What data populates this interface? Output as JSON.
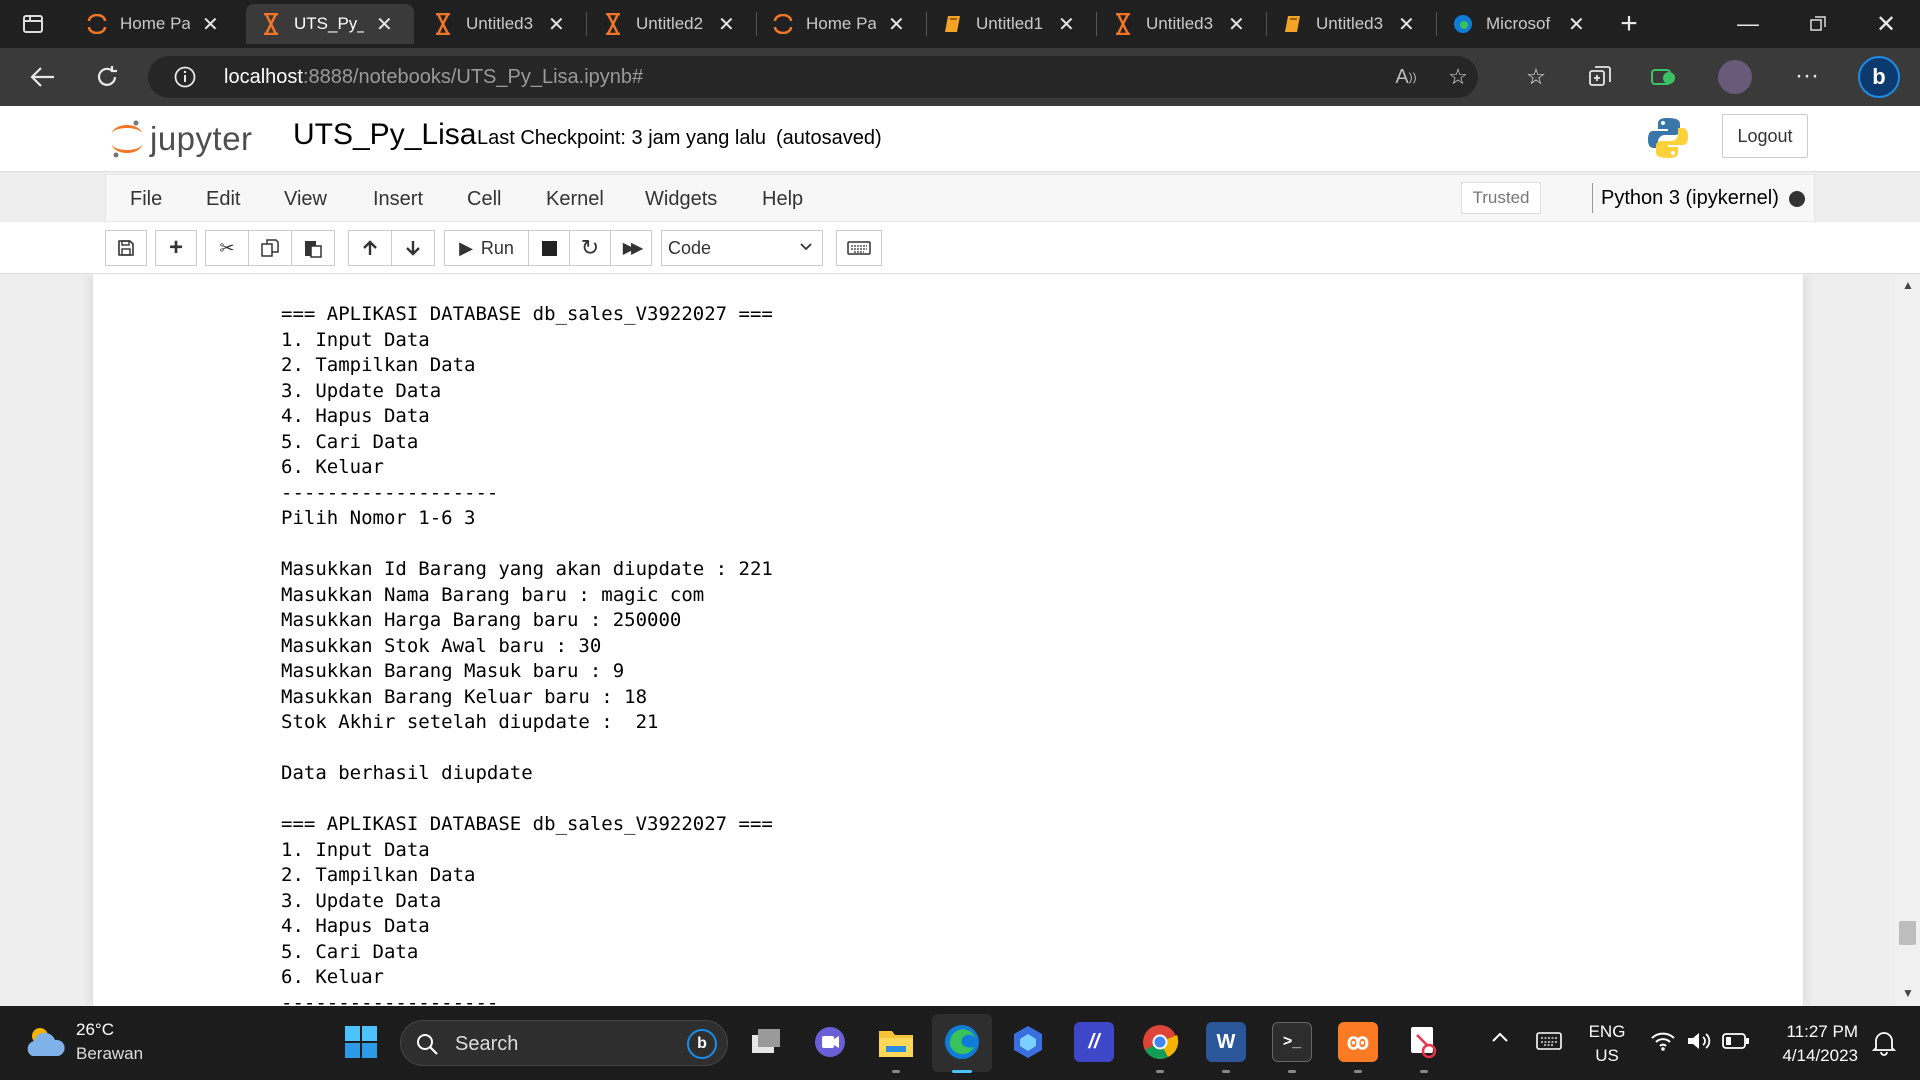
{
  "browser": {
    "tabs": [
      {
        "title": "Home Pa",
        "icon": "jupyter-logo-icon"
      },
      {
        "title": "UTS_Py_L",
        "icon": "hourglass-icon"
      },
      {
        "title": "Untitled3",
        "icon": "hourglass-icon"
      },
      {
        "title": "Untitled2",
        "icon": "hourglass-icon"
      },
      {
        "title": "Home Pa",
        "icon": "jupyter-logo-icon"
      },
      {
        "title": "Untitled1",
        "icon": "book-icon"
      },
      {
        "title": "Untitled3",
        "icon": "hourglass-icon"
      },
      {
        "title": "Untitled3",
        "icon": "book-icon"
      },
      {
        "title": "Microsof",
        "icon": "edge-icon"
      }
    ],
    "url_host": "localhost",
    "url_path": ":8888/notebooks/UTS_Py_Lisa.ipynb#"
  },
  "jupyter": {
    "logo_text": "jupyter",
    "notebook_name": "UTS_Py_Lisa",
    "checkpoint": "Last Checkpoint: 3 jam yang lalu",
    "autosave": "(autosaved)",
    "logout": "Logout",
    "menus": [
      "File",
      "Edit",
      "View",
      "Insert",
      "Cell",
      "Kernel",
      "Widgets",
      "Help"
    ],
    "trusted": "Trusted",
    "kernel": "Python 3 (ipykernel)",
    "run_label": "Run",
    "cell_type": "Code"
  },
  "output_lines": [
    "=== APLIKASI DATABASE db_sales_V3922027 ===",
    "1. Input Data",
    "2. Tampilkan Data",
    "3. Update Data",
    "4. Hapus Data",
    "5. Cari Data",
    "6. Keluar",
    "-------------------",
    "Pilih Nomor 1-6 3",
    "",
    "Masukkan Id Barang yang akan diupdate : 221",
    "Masukkan Nama Barang baru : magic com",
    "Masukkan Harga Barang baru : 250000",
    "Masukkan Stok Awal baru : 30",
    "Masukkan Barang Masuk baru : 9",
    "Masukkan Barang Keluar baru : 18",
    "Stok Akhir setelah diupdate :  21",
    "",
    "Data berhasil diupdate",
    "",
    "=== APLIKASI DATABASE db_sales_V3922027 ===",
    "1. Input Data",
    "2. Tampilkan Data",
    "3. Update Data",
    "4. Hapus Data",
    "5. Cari Data",
    "6. Keluar",
    "-------------------"
  ],
  "taskbar": {
    "temperature": "26°C",
    "weather": "Berawan",
    "search": "Search",
    "lang1": "ENG",
    "lang2": "US",
    "time": "11:27 PM",
    "date": "4/14/2023"
  },
  "colors": {
    "jupyter_orange": "#f37626",
    "edge_blue": "#0f7cd8",
    "taskbar": "#1c1c1c"
  }
}
